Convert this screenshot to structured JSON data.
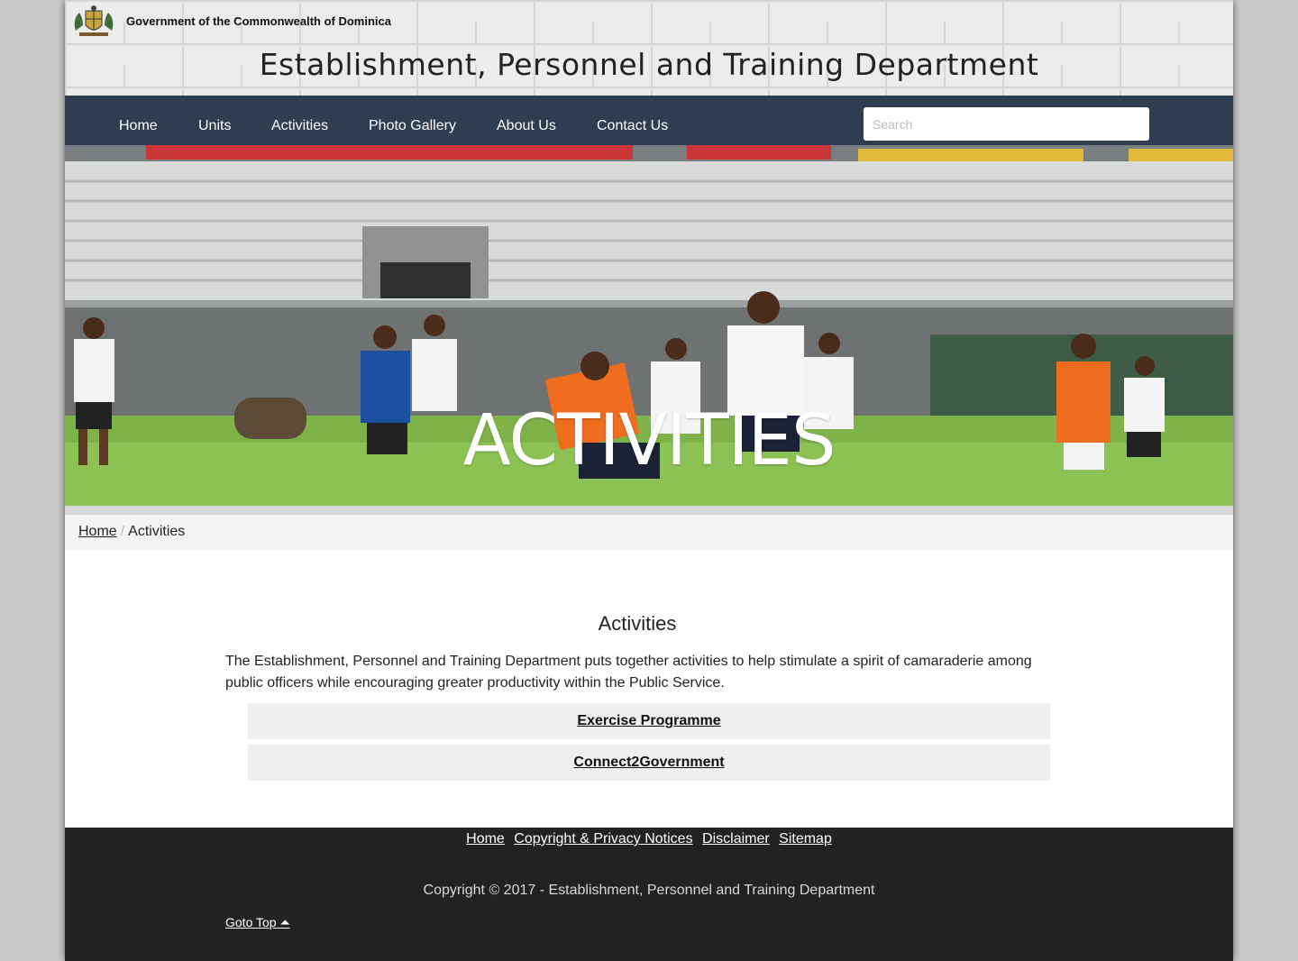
{
  "header": {
    "gov_name": "Government of the Commonwealth of Dominica",
    "dept_title": "Establishment, Personnel and Training Department",
    "crest_icon": "coat-of-arms-icon"
  },
  "nav": {
    "items": [
      {
        "label": "Home"
      },
      {
        "label": "Units"
      },
      {
        "label": "Activities"
      },
      {
        "label": "Photo Gallery"
      },
      {
        "label": "About Us"
      },
      {
        "label": "Contact Us"
      }
    ],
    "search_placeholder": "Search"
  },
  "hero": {
    "title": "ACTIVITIES"
  },
  "breadcrumb": {
    "home": "Home",
    "separator": "/",
    "current": "Activities"
  },
  "main": {
    "title": "Activities",
    "intro": "The Establishment, Personnel and Training Department puts together activities to help stimulate a spirit of camaraderie among public officers while encouraging greater productivity within the Public Service.",
    "links": [
      {
        "label": "Exercise Programme"
      },
      {
        "label": "Connect2Government"
      }
    ]
  },
  "footer": {
    "links": [
      {
        "label": "Home"
      },
      {
        "label": "Copyright & Privacy Notices"
      },
      {
        "label": "Disclaimer"
      },
      {
        "label": "Sitemap"
      }
    ],
    "copyright": "Copyright © 2017 - Establishment, Personnel and Training Department",
    "goto_top": "Goto Top ⏶"
  },
  "colors": {
    "navbar": "#2e3d4f",
    "footer": "#222222",
    "page_bg": "#c8c8c8"
  }
}
